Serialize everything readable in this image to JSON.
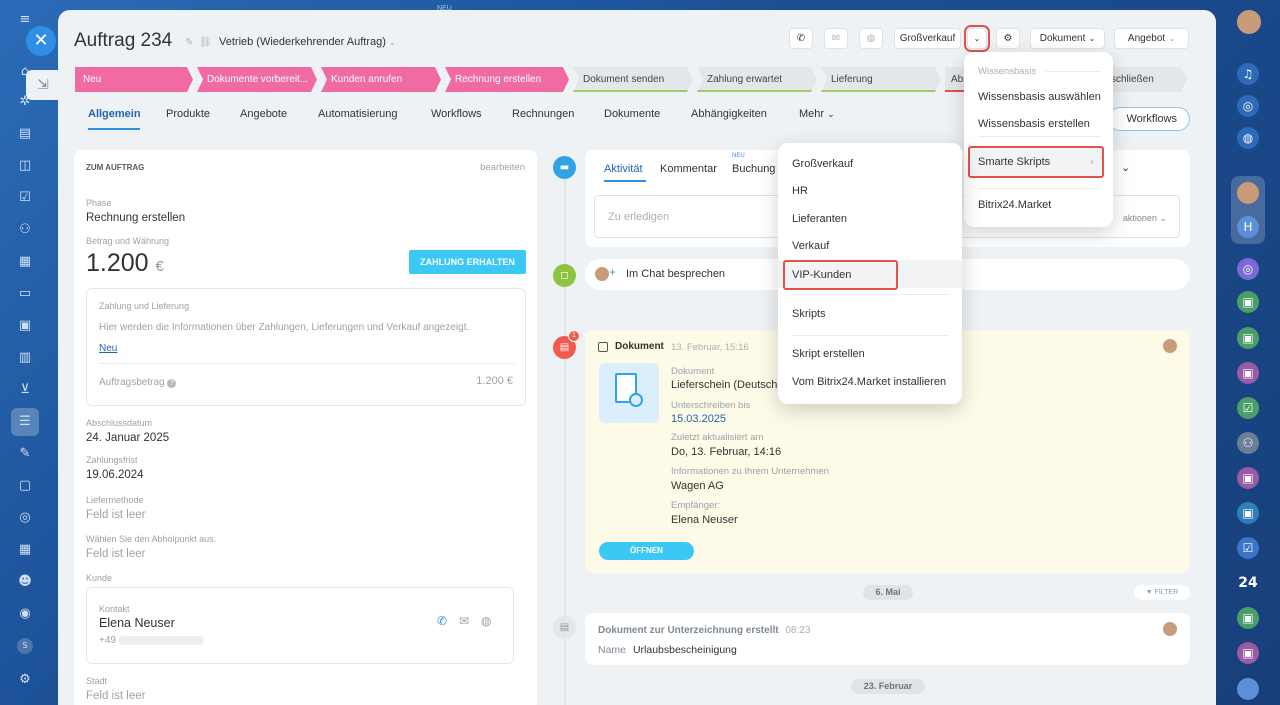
{
  "top_badge": "NEU",
  "title": "Auftrag 234",
  "pipeline": "Vetrieb (Wiederkehrender Auftrag)",
  "header": {
    "price_type": "Großverkauf",
    "document": "Dokument",
    "offer": "Angebot"
  },
  "stages": [
    {
      "label": "Neu",
      "color": "#f06aa4"
    },
    {
      "label": "Dokumente vorbereit...",
      "color": "#f06aa4"
    },
    {
      "label": "Kunden anrufen",
      "color": "#f06aa4"
    },
    {
      "label": "Rechnung erstellen",
      "color": "#f06aa4"
    },
    {
      "label": "Dokument senden",
      "color": "#e4e7ea"
    },
    {
      "label": "Zahlung erwartet",
      "color": "#e4e7ea"
    },
    {
      "label": "Lieferung",
      "color": "#e4e7ea"
    },
    {
      "label": "Abs",
      "color": "#e4e7ea"
    },
    {
      "label": "schließen",
      "color": "#e4e7ea"
    }
  ],
  "tabs": [
    "Allgemein",
    "Produkte",
    "Angebote",
    "Automatisierung",
    "Workflows",
    "Rechnungen",
    "Dokumente",
    "Abhängigkeiten",
    "Mehr"
  ],
  "workflows_button": "Workflows",
  "left": {
    "section_title": "ZUM AUFTRAG",
    "edit": "bearbeiten",
    "phase_label": "Phase",
    "phase_value": "Rechnung erstellen",
    "amount_label": "Betrag und Währung",
    "amount_value": "1.200",
    "currency": "€",
    "pay_button": "ZAHLUNG ERHALTEN",
    "payment_title": "Zahlung und Lieferung",
    "payment_text": "Hier werden die Informationen über Zahlungen, Lieferungen und Verkauf angezeigt.",
    "payment_new": "Neu",
    "order_amount_label": "Auftragsbetrag",
    "order_amount_value": "1.200 €",
    "close_date_label": "Abschlussdatum",
    "close_date_value": "24. Januar 2025",
    "due_label": "Zahlungsfrist",
    "due_value": "19.06.2024",
    "delivery_label": "Liefermethode",
    "delivery_value": "Feld ist leer",
    "pickup_label": "Wählen Sie den Abholpunkt aus.",
    "pickup_value": "Feld ist leer",
    "customer_label": "Kunde",
    "contact_label": "Kontakt",
    "contact_name": "Elena Neuser",
    "contact_phone": "+49",
    "city_label": "Stadt",
    "city_value": "Feld ist leer"
  },
  "activity": {
    "tabs": [
      "Aktivität",
      "Kommentar",
      "Buchung"
    ],
    "booking_badge": "NEU",
    "todo_placeholder": "Zu erledigen",
    "actions_partial": "aktionen",
    "chat": "Im Chat besprechen"
  },
  "doc": {
    "badge": "1",
    "title": "Dokument",
    "date": "13. Februar, 15:16",
    "type_label": "Dokument",
    "type_value": "Lieferschein (Deutsch",
    "sign_label": "Unterschreiben bis",
    "sign_value": "15.03.2025",
    "updated_label": "Zuletzt aktualisiert am",
    "updated_value": "Do, 13. Februar, 14:16",
    "company_label": "Informationen zu Ihrem Unternehmen",
    "company_value": "Wagen AG",
    "recipient_label": "Empfänger:",
    "recipient_value": "Elena Neuser",
    "open_button": "ÖFFNEN"
  },
  "date_pill_1": "6. Mai",
  "filter": "FILTER",
  "sig": {
    "title": "Dokument zur Unterzeichnung erstellt",
    "time": "08:23",
    "name_label": "Name",
    "name_value": "Urlaubsbescheinigung"
  },
  "date_pill_2": "23. Februar",
  "knowledge_menu": {
    "header": "Wissensbasis",
    "items": [
      "Wissensbasis auswählen",
      "Wissensbasis erstellen",
      "Smarte Skripts",
      "Bitrix24.Market"
    ]
  },
  "scripts_menu": {
    "items": [
      "Großverkauf",
      "HR",
      "Lieferanten",
      "Verkauf",
      "VIP-Kunden",
      "Skripts",
      "Skript erstellen",
      "Vom Bitrix24.Market installieren"
    ]
  },
  "right_sidebar": {
    "badge_24": "24",
    "avatar_h": "H",
    "small_s": "S"
  }
}
